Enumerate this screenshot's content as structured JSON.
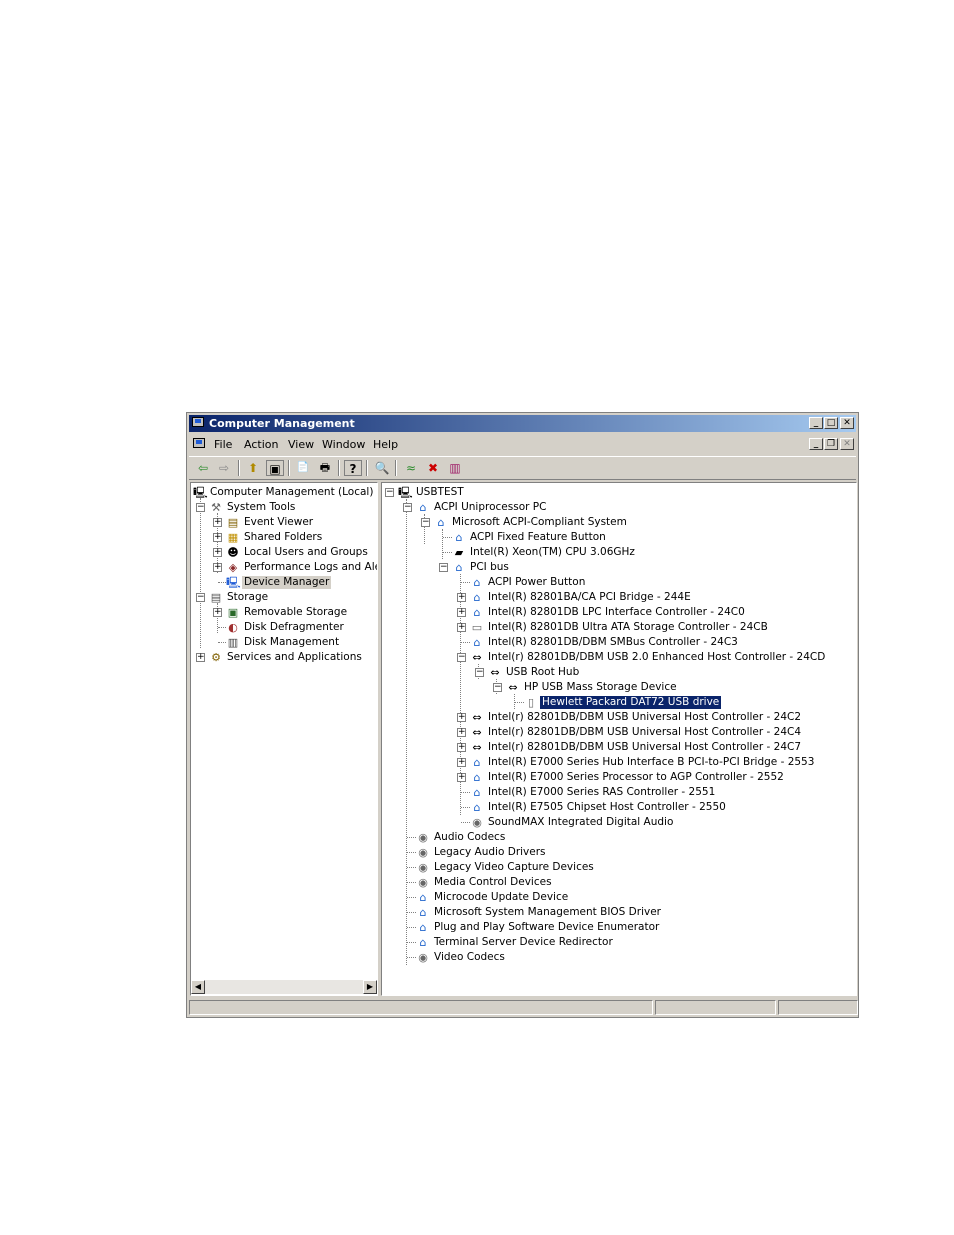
{
  "window": {
    "title": "Computer Management",
    "minimize": "_",
    "maximize": "□",
    "close": "✕"
  },
  "menu": {
    "file": "File",
    "action": "Action",
    "view": "View",
    "window": "Window",
    "help": "Help",
    "mdi_min": "_",
    "mdi_restore": "❐",
    "mdi_close": "✕"
  },
  "toolbar": {
    "back": "⇦",
    "forward": "⇨",
    "up": "⬆",
    "showhide": "▣",
    "properties": "📄",
    "print": "🖶",
    "help": "?",
    "scan": "🔍",
    "i1": "≈",
    "i2": "✖",
    "i3": "▥"
  },
  "left_tree": {
    "root": "Computer Management (Local)",
    "system_tools": "System Tools",
    "event_viewer": "Event Viewer",
    "shared_folders": "Shared Folders",
    "local_users": "Local Users and Groups",
    "perf_logs": "Performance Logs and Alerts",
    "device_manager": "Device Manager",
    "storage": "Storage",
    "removable": "Removable Storage",
    "defrag": "Disk Defragmenter",
    "disk_mgmt": "Disk Management",
    "services": "Services and Applications"
  },
  "right_tree": [
    "USBTEST",
    "ACPI Uniprocessor PC",
    "Microsoft ACPI-Compliant System",
    "ACPI Fixed Feature Button",
    "Intel(R) Xeon(TM) CPU 3.06GHz",
    "PCI bus",
    "ACPI Power Button",
    "Intel(R) 82801BA/CA PCI Bridge - 244E",
    "Intel(R) 82801DB LPC Interface Controller - 24C0",
    "Intel(R) 82801DB Ultra ATA Storage Controller - 24CB",
    "Intel(R) 82801DB/DBM SMBus Controller - 24C3",
    "Intel(r) 82801DB/DBM USB 2.0 Enhanced Host Controller - 24CD",
    "USB Root Hub",
    "HP USB Mass Storage Device",
    "Hewlett Packard DAT72 USB drive",
    "Intel(r) 82801DB/DBM USB Universal Host Controller - 24C2",
    "Intel(r) 82801DB/DBM USB Universal Host Controller - 24C4",
    "Intel(r) 82801DB/DBM USB Universal Host Controller - 24C7",
    "Intel(R) E7000 Series Hub Interface B PCI-to-PCI Bridge - 2553",
    "Intel(R) E7000 Series Processor to AGP Controller - 2552",
    "Intel(R) E7000 Series RAS Controller - 2551",
    "Intel(R) E7505 Chipset Host Controller - 2550",
    "SoundMAX Integrated Digital Audio",
    "Audio Codecs",
    "Legacy Audio Drivers",
    "Legacy Video Capture Devices",
    "Media Control Devices",
    "Microcode Update Device",
    "Microsoft System Management BIOS Driver",
    "Plug and Play Software Device Enumerator",
    "Terminal Server Device Redirector",
    "Video Codecs"
  ],
  "icons": {
    "computer": "🖳",
    "device": "⌂",
    "usb": "⇔",
    "cpu": "▰",
    "drive": "▭",
    "sound": "◉",
    "tape": "▯",
    "plus": "+",
    "minus": "−",
    "tools": "⚒",
    "event": "▤",
    "folder": "▦",
    "users": "☻",
    "perf": "◈",
    "devmgr": "🖳",
    "storage": "▤",
    "removable": "▣",
    "defrag": "◐",
    "disk": "▥",
    "services": "⚙"
  },
  "scroll": {
    "left": "◀",
    "right": "▶"
  }
}
